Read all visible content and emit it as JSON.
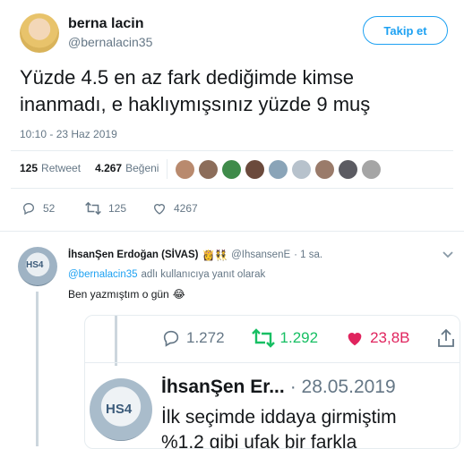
{
  "tweet": {
    "author_name": "berna lacin",
    "author_handle": "@bernalacin35",
    "follow_label": "Takip et",
    "text_line1": "Yüzde 4.5 en az fark dediğimde kimse",
    "text_line2": "inanmadı, e haklıymışsınız yüzde 9 muş",
    "timestamp": "10:10 - 23 Haz 2019",
    "retweet_count": "125",
    "retweet_label": "Retweet",
    "like_count": "4.267",
    "like_label": "Beğeni",
    "actions": {
      "replies": "52",
      "retweets": "125",
      "likes": "4267"
    }
  },
  "reply": {
    "author_name": "İhsanŞen Erdoğan (SİVAS)",
    "emoji": "👸👯",
    "author_handle": "@IhsansenE",
    "time": "· 1 sa.",
    "reply_to_handle": "@bernalacin35",
    "reply_to_suffix": "adlı kullanıcıya yanıt olarak",
    "text": "Ben yazmıştım o gün",
    "text_emoji": "😂"
  },
  "embedded": {
    "comments": "1.272",
    "retweets": "1.292",
    "likes": "23,8B",
    "author_name": "İhsanŞen Er...",
    "date": "· 28.05.2019",
    "text_line1": "İlk seçimde iddaya girmiştim",
    "text_line2": "%1,2 gibi ufak bir farkla"
  },
  "colors": {
    "brand": "#1da1f2",
    "retweet_green": "#17bf63",
    "like_red": "#e0245e",
    "muted": "#657786"
  }
}
